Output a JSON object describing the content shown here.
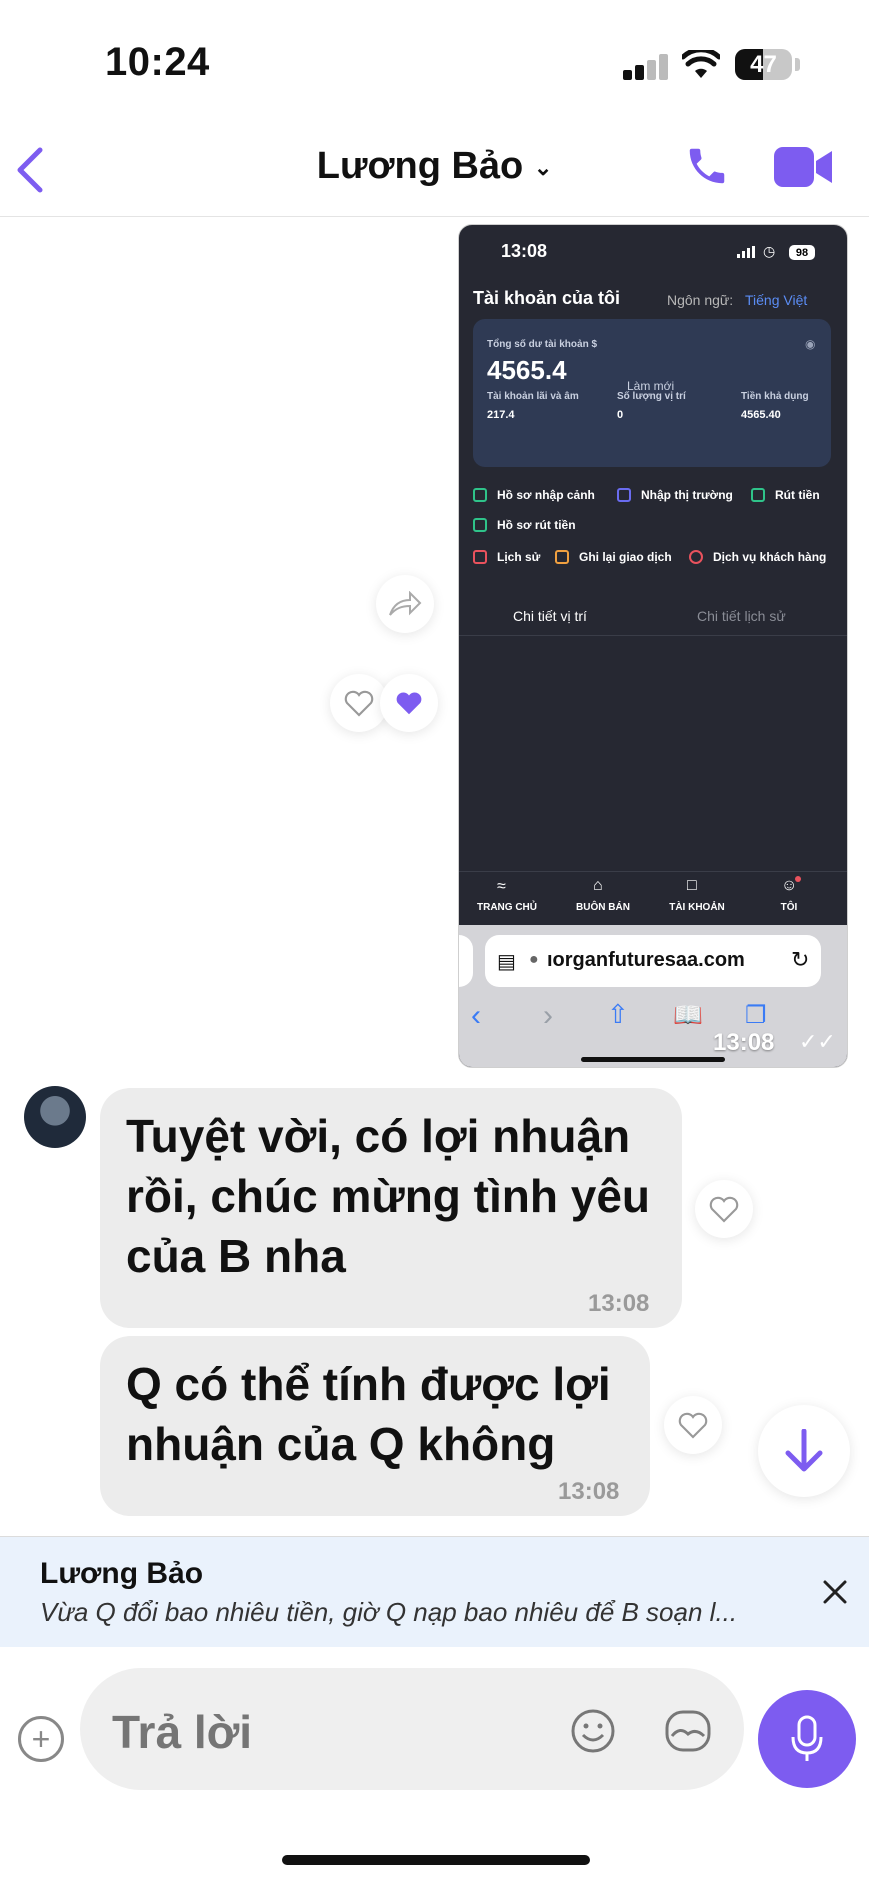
{
  "status_bar": {
    "time": "10:24",
    "battery": "47"
  },
  "header": {
    "title": "Lương Bảo"
  },
  "shared_screenshot": {
    "time": "13:08",
    "battery": "98",
    "account_title": "Tài khoản của tôi",
    "language_label": "Ngôn ngữ:",
    "language_value": "Tiếng Việt",
    "balance_label": "Tổng số dư tài khoản $",
    "balance_value": "4565.4",
    "refresh_label": "Làm mới",
    "pnl_label": "Tài khoản lãi và âm",
    "pnl_value": "217.4",
    "positions_label": "Số lượng vị trí",
    "positions_value": "0",
    "available_label": "Tiền khả dụng",
    "available_value": "4565.40",
    "menu": [
      "Hồ sơ nhập cảnh",
      "Nhập thị trường",
      "Rút tiền",
      "Hồ sơ rút tiền",
      "Lịch sử",
      "Ghi lại giao dịch",
      "Dịch vụ khách hàng"
    ],
    "tab_positions": "Chi tiết vị trí",
    "tab_history": "Chi tiết lịch sử",
    "nav": [
      "TRANG CHỦ",
      "BUÔN BÁN",
      "TÀI KHOẢN",
      "TÔI"
    ],
    "url": "ıorganfuturesaa.com",
    "timestamp": "13:08"
  },
  "messages": [
    {
      "text": "Tuyệt vời, có lợi nhuận rồi, chúc mừng tình yêu của B nha",
      "time": "13:08"
    },
    {
      "text": "Q có thể tính được lợi nhuận của Q không",
      "time": "13:08"
    }
  ],
  "reply": {
    "name": "Lương Bảo",
    "text": "Vừa Q đổi bao nhiêu tiền, giờ Q nạp bao nhiêu để B soạn l..."
  },
  "composer": {
    "placeholder": "Trả lời"
  },
  "colors": {
    "accent": "#7d5cf0",
    "bubble": "#ececec",
    "reply_bg": "#eaf2fc"
  }
}
